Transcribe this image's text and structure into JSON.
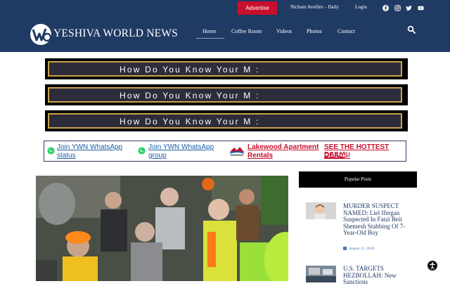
{
  "header": {
    "advertise_label": "Advertise",
    "nichum_label": "Nichum Aveilim – Daily",
    "login_label": "Login",
    "brand": "YESHIVA WORLD NEWS",
    "nav": [
      "Home",
      "Coffee Room",
      "Videos",
      "Photos",
      "Contact"
    ],
    "social_icons": [
      "facebook-icon",
      "instagram-icon",
      "twitter-icon",
      "youtube-icon"
    ]
  },
  "banners": [
    {
      "text": "How Do You Know Your M :"
    },
    {
      "text": "How Do You Know Your M :"
    },
    {
      "text": "How Do You Know Your M :"
    }
  ],
  "whatsapp_bar": {
    "status_line1": "Join YWN WhatsApp",
    "status_line2": "status",
    "group_line1": "Join YWN WhatsApp",
    "group_line2": "group",
    "lakewood_line1": "Lakewood Apartment",
    "lakewood_line2": "Rentals",
    "deals_line1": "SEE THE HOTTEST DAILY",
    "deals_line2": "DEALS!"
  },
  "sidebar": {
    "title": "Popular Posts",
    "posts": [
      {
        "title": "MURDER SUSPECT NAMED: Liel Ifergan Suspected In Fatal Beit Shemesh Stabbing Of 7-Year-Old Boy",
        "date": "August 21, 2026"
      },
      {
        "title": "U.S. TARGETS HEZBOLLAH: New Sanctions",
        "date": ""
      }
    ]
  },
  "colors": {
    "header_bg": "#1f3a63",
    "advertise_bg": "#c8102e",
    "link_blue": "#1a5ea8",
    "alert_red": "#c8102e",
    "banner_gold": "#c9a24a"
  }
}
